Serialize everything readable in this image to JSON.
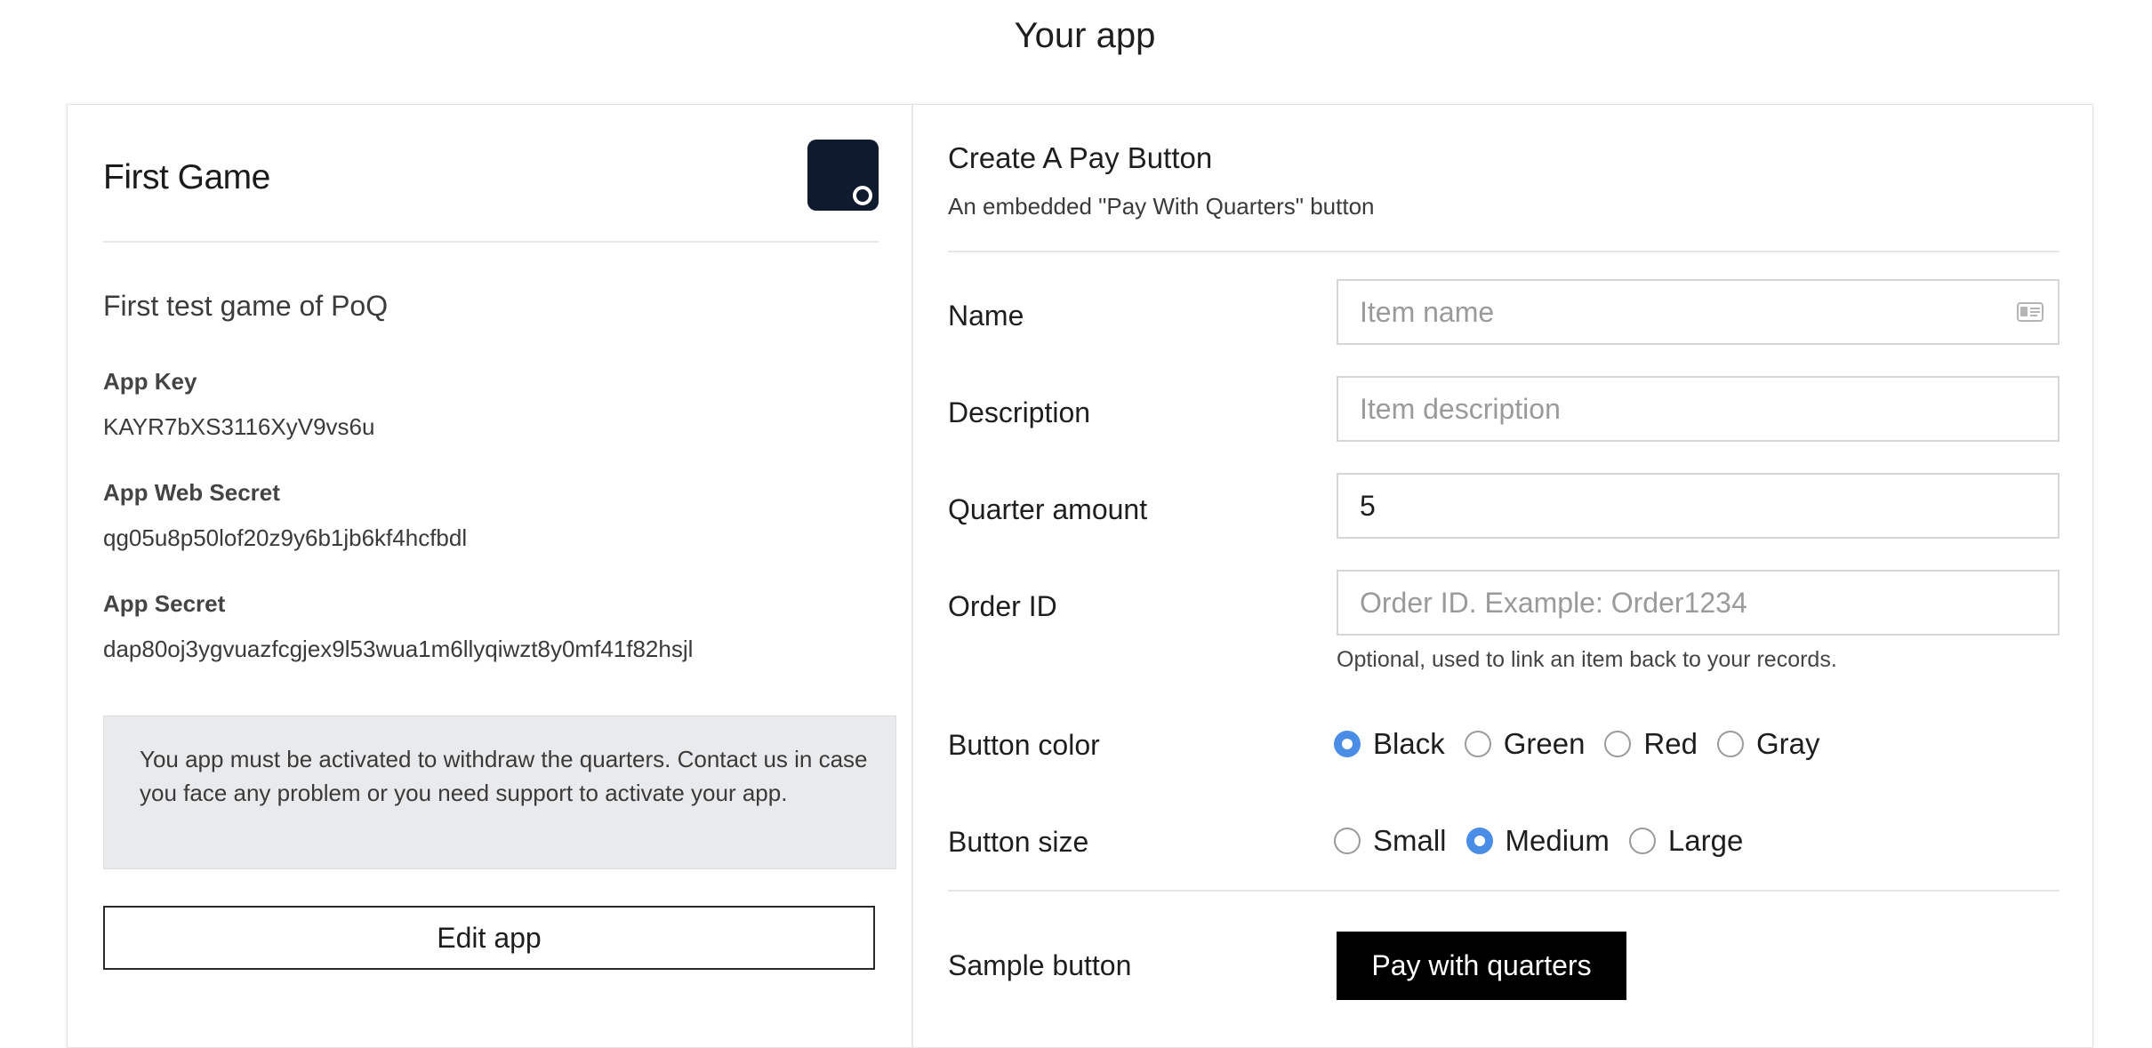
{
  "page": {
    "title": "Your app"
  },
  "app": {
    "name": "First Game",
    "description": "First test game of PoQ",
    "key_label": "App Key",
    "key_value": "KAYR7bXS3116XyV9vs6u",
    "web_secret_label": "App Web Secret",
    "web_secret_value": "qg05u8p50lof20z9y6b1jb6kf4hcfbdl",
    "secret_label": "App Secret",
    "secret_value": "dap80oj3ygvuazfcgjex9l53wua1m6llyqiwzt8y0mf41f82hsjl",
    "notice": "You app must be activated to withdraw the quarters. Contact us in case you face any problem or you need support to activate your app.",
    "edit_label": "Edit app",
    "logo_color": "#101a2e"
  },
  "form": {
    "title": "Create A Pay Button",
    "subtitle": "An embedded \"Pay With Quarters\" button",
    "name_label": "Name",
    "name_placeholder": "Item name",
    "name_value": "",
    "description_label": "Description",
    "description_placeholder": "Item description",
    "description_value": "",
    "quarter_label": "Quarter amount",
    "quarter_value": "5",
    "order_label": "Order ID",
    "order_placeholder": "Order ID. Example: Order1234",
    "order_value": "",
    "order_help": "Optional, used to link an item back to your records.",
    "color_label": "Button color",
    "color_options": [
      "Black",
      "Green",
      "Red",
      "Gray"
    ],
    "color_selected": "Black",
    "size_label": "Button size",
    "size_options": [
      "Small",
      "Medium",
      "Large"
    ],
    "size_selected": "Medium",
    "sample_label": "Sample button",
    "sample_button_label": "Pay with quarters",
    "accent_color": "#4a8de6"
  }
}
